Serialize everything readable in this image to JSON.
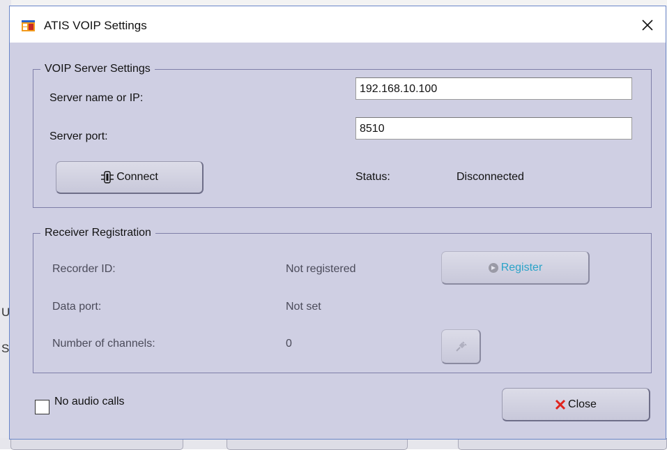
{
  "window": {
    "title": "ATIS VOIP Settings",
    "icon": "app-window-icon",
    "close_icon": "close-x-icon"
  },
  "server_settings": {
    "legend": "VOIP Server Settings",
    "server_label": "Server name or IP:",
    "server_value": "192.168.10.100",
    "port_label": "Server port:",
    "port_value": "8510",
    "connect_label": "Connect",
    "connect_icon": "plug-connector-icon",
    "status_label": "Status:",
    "status_value": "Disconnected"
  },
  "receiver_registration": {
    "legend": "Receiver Registration",
    "recorder_id_label": "Recorder ID:",
    "recorder_id_value": "Not registered",
    "register_label": "Register",
    "register_icon": "register-icon",
    "data_port_label": "Data port:",
    "data_port_value": "Not set",
    "channels_label": "Number of channels:",
    "channels_value": "0",
    "plug_button_icon": "plug-icon"
  },
  "footer": {
    "no_audio_label": "No audio calls",
    "no_audio_checked": false,
    "close_label": "Close",
    "close_icon": "red-x-icon"
  },
  "colors": {
    "dialog_bg": "#cfcfe3",
    "register_text": "#2aa3c8",
    "close_icon": "#e0231c"
  }
}
